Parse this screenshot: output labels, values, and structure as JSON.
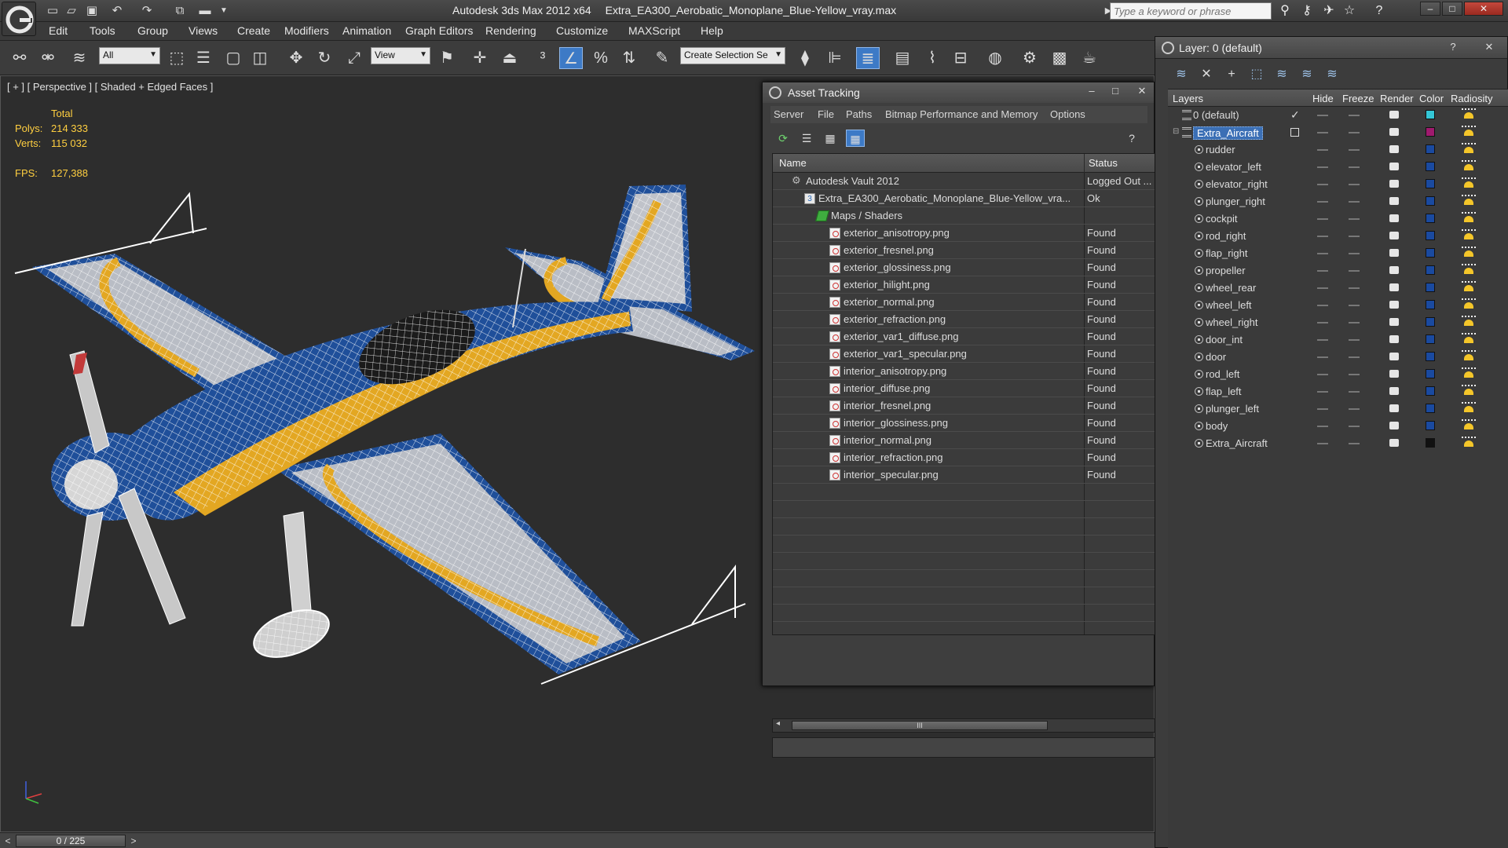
{
  "window": {
    "app_title": "Autodesk 3ds Max  2012 x64",
    "file_name": "Extra_EA300_Aerobatic_Monoplane_Blue-Yellow_vray.max",
    "search_placeholder": "Type a keyword or phrase"
  },
  "menu": [
    "Edit",
    "Tools",
    "Group",
    "Views",
    "Create",
    "Modifiers",
    "Animation",
    "Graph Editors",
    "Rendering",
    "Customize",
    "MAXScript",
    "Help"
  ],
  "toolbar": {
    "selection_filter": "All",
    "ref_coord": "View",
    "named_selection_placeholder": "Create Selection Se"
  },
  "viewport": {
    "label": "[ + ] [ Perspective ] [ Shaded + Edged Faces ]",
    "stats_header": "Total",
    "polys_label": "Polys:",
    "polys_value": "214 333",
    "verts_label": "Verts:",
    "verts_value": "115 032",
    "fps_label": "FPS:",
    "fps_value": "127,388"
  },
  "timeslider": {
    "value": "0 / 225",
    "prev": "<",
    "next": ">"
  },
  "asset_tracking": {
    "title": "Asset Tracking",
    "menu": [
      "Server",
      "File",
      "Paths",
      "Bitmap Performance and Memory",
      "Options"
    ],
    "columns": {
      "name": "Name",
      "status": "Status"
    },
    "rows": [
      {
        "name": "Autodesk Vault 2012",
        "status": "Logged Out ..."
      },
      {
        "name": "Extra_EA300_Aerobatic_Monoplane_Blue-Yellow_vra...",
        "status": "Ok"
      },
      {
        "name": "Maps / Shaders",
        "status": ""
      },
      {
        "name": "exterior_anisotropy.png",
        "status": "Found"
      },
      {
        "name": "exterior_fresnel.png",
        "status": "Found"
      },
      {
        "name": "exterior_glossiness.png",
        "status": "Found"
      },
      {
        "name": "exterior_hilight.png",
        "status": "Found"
      },
      {
        "name": "exterior_normal.png",
        "status": "Found"
      },
      {
        "name": "exterior_refraction.png",
        "status": "Found"
      },
      {
        "name": "exterior_var1_diffuse.png",
        "status": "Found"
      },
      {
        "name": "exterior_var1_specular.png",
        "status": "Found"
      },
      {
        "name": "interior_anisotropy.png",
        "status": "Found"
      },
      {
        "name": "interior_diffuse.png",
        "status": "Found"
      },
      {
        "name": "interior_fresnel.png",
        "status": "Found"
      },
      {
        "name": "interior_glossiness.png",
        "status": "Found"
      },
      {
        "name": "interior_normal.png",
        "status": "Found"
      },
      {
        "name": "interior_refraction.png",
        "status": "Found"
      },
      {
        "name": "interior_specular.png",
        "status": "Found"
      }
    ],
    "scroll_grip": "III"
  },
  "layers": {
    "title": "Layer: 0 (default)",
    "columns": {
      "layers": "Layers",
      "hide": "Hide",
      "freeze": "Freeze",
      "render": "Render",
      "color": "Color",
      "radiosity": "Radiosity"
    },
    "rows": [
      {
        "name": "0 (default)",
        "color": "#34c6d6"
      },
      {
        "name": "Extra_Aircraft",
        "color": "#a01a6e"
      },
      {
        "name": "rudder",
        "color": "#1a4aa0"
      },
      {
        "name": "elevator_left",
        "color": "#1a4aa0"
      },
      {
        "name": "elevator_right",
        "color": "#1a4aa0"
      },
      {
        "name": "plunger_right",
        "color": "#1a4aa0"
      },
      {
        "name": "cockpit",
        "color": "#1a4aa0"
      },
      {
        "name": "rod_right",
        "color": "#1a4aa0"
      },
      {
        "name": "flap_right",
        "color": "#1a4aa0"
      },
      {
        "name": "propeller",
        "color": "#1a4aa0"
      },
      {
        "name": "wheel_rear",
        "color": "#1a4aa0"
      },
      {
        "name": "wheel_left",
        "color": "#1a4aa0"
      },
      {
        "name": "wheel_right",
        "color": "#1a4aa0"
      },
      {
        "name": "door_int",
        "color": "#1a4aa0"
      },
      {
        "name": "door",
        "color": "#1a4aa0"
      },
      {
        "name": "rod_left",
        "color": "#1a4aa0"
      },
      {
        "name": "flap_left",
        "color": "#1a4aa0"
      },
      {
        "name": "plunger_left",
        "color": "#1a4aa0"
      },
      {
        "name": "body",
        "color": "#1a4aa0"
      },
      {
        "name": "Extra_Aircraft",
        "color": "#111111"
      }
    ]
  },
  "colors": {
    "accent": "#3d7ac6",
    "stats": "#ffcf40",
    "plane_blue": "#1f4f9a",
    "plane_yellow": "#e3a722"
  }
}
